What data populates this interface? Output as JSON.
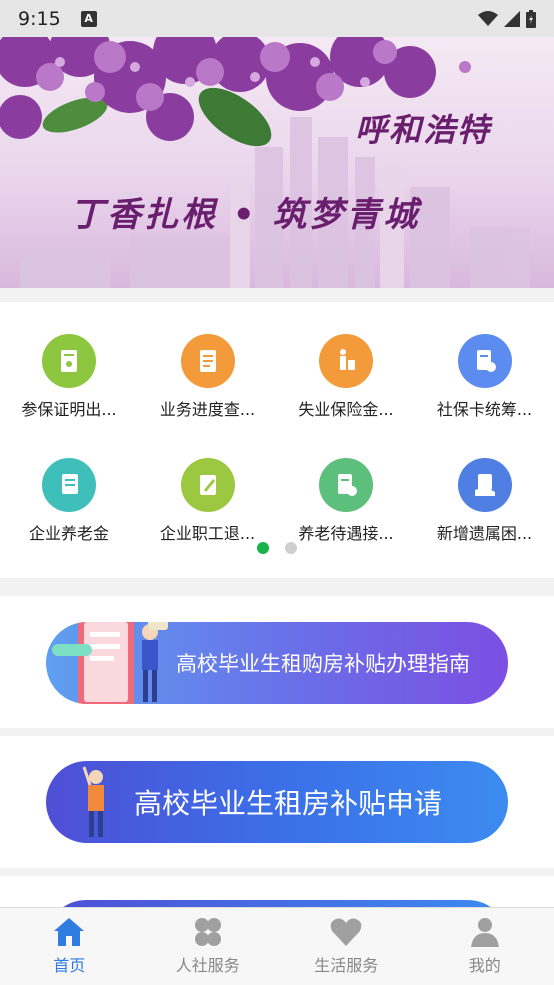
{
  "status_bar": {
    "time": "9:15",
    "notif": "A"
  },
  "banner": {
    "title_city": "呼和浩特",
    "slogan": "丁香扎根 • 筑梦青城"
  },
  "services": [
    {
      "label": "参保证明出...",
      "icon": "certificate-icon",
      "color": "#8dc63f"
    },
    {
      "label": "业务进度查...",
      "icon": "progress-list-icon",
      "color": "#f39a3b"
    },
    {
      "label": "失业保险金...",
      "icon": "person-luggage-icon",
      "color": "#f39a3b"
    },
    {
      "label": "社保卡统筹...",
      "icon": "card-doc-icon",
      "color": "#5c8cf0"
    },
    {
      "label": "企业养老金",
      "icon": "pension-doc-icon",
      "color": "#3fbfb9"
    },
    {
      "label": "企业职工退...",
      "icon": "edit-doc-icon",
      "color": "#9bc840"
    },
    {
      "label": "养老待遇接...",
      "icon": "transfer-doc-icon",
      "color": "#5dbf7c"
    },
    {
      "label": "新增遗属困...",
      "icon": "hand-doc-icon",
      "color": "#4f7fe3"
    }
  ],
  "pager": {
    "pages": 2,
    "active": 0
  },
  "promos": [
    {
      "label": "高校毕业生租购房补贴办理指南"
    },
    {
      "label": "高校毕业生租房补贴申请"
    }
  ],
  "tabs": [
    {
      "label": "首页",
      "icon": "home-icon",
      "active": true
    },
    {
      "label": "人社服务",
      "icon": "four-leaf-icon",
      "active": false
    },
    {
      "label": "生活服务",
      "icon": "heart-icon",
      "active": false
    },
    {
      "label": "我的",
      "icon": "user-icon",
      "active": false
    }
  ]
}
